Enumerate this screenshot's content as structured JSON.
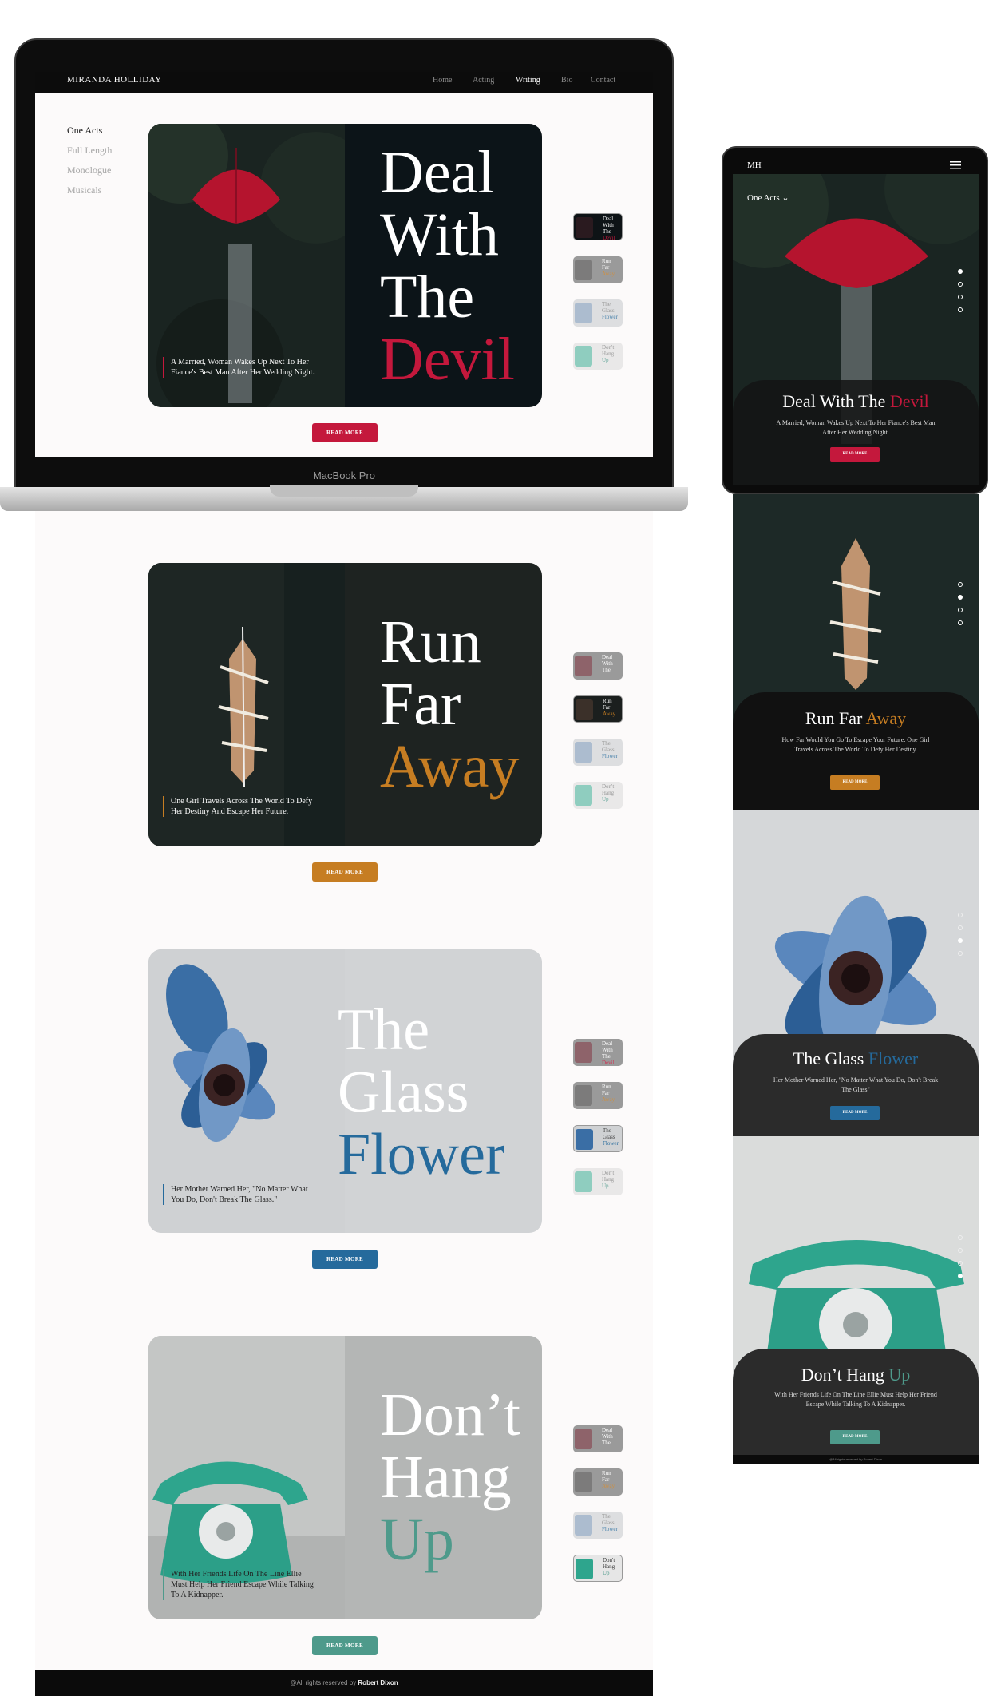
{
  "desktop": {
    "brand": "MIRANDA HOLLIDAY",
    "nav": [
      "Home",
      "Acting",
      "Writing",
      "Bio",
      "Contact"
    ],
    "nav_active": "Writing",
    "sidebar": [
      "One Acts",
      "Full Length",
      "Monologue",
      "Musicals"
    ],
    "device_label": "MacBook Pro",
    "read_more": "READ MORE",
    "footer": {
      "prefix": "@All rights reserved by",
      "name": "Robert Dixon"
    }
  },
  "plays": [
    {
      "title_line1": "Deal",
      "title_line2": "With",
      "title_line3": "The",
      "title_accent": "Devil",
      "accent_color": "#c4183c",
      "tagline": "A Married, Woman Wakes Up Next To Her Fiance's Best Man After Her Wedding Night.",
      "mobile_title": "Deal With The",
      "mobile_accent": "Devil",
      "mobile_desc": "A Married, Woman Wakes Up Next To Her Fiance's Best Man After Her Wedding Night."
    },
    {
      "title_line1": "Run",
      "title_line2": "Far",
      "title_line3": "",
      "title_accent": "Away",
      "accent_color": "#c67d22",
      "tagline": "One Girl Travels Across The World To Defy Her Destiny And Escape Her Future.",
      "mobile_title": "Run Far",
      "mobile_accent": "Away",
      "mobile_desc": "How Far Would You Go To Escape Your Future. One Girl Travels Across The World To Defy Her Destiny."
    },
    {
      "title_line1": "The",
      "title_line2": "Glass",
      "title_line3": "",
      "title_accent": "Flower",
      "accent_color": "#256a9c",
      "tagline": "Her Mother Warned Her, \"No Matter What You Do, Don't Break The Glass.\"",
      "mobile_title": "The Glass",
      "mobile_accent": "Flower",
      "mobile_desc": "Her Mother Warned Her, \"No Matter What You Do, Don't Break The Glass\""
    },
    {
      "title_line1": "Don’t",
      "title_line2": "Hang",
      "title_line3": "",
      "title_accent": "Up",
      "accent_color": "#4e9a8b",
      "tagline": "With Her Friends Life On The Line Ellie Must Help Her Friend Escape While Talking To A Kidnapper.",
      "mobile_title": "Don’t Hang",
      "mobile_accent": "Up",
      "mobile_desc": "With Her Friends Life On The Line Ellie Must Help Her Friend Escape While Talking To A Kidnapper."
    }
  ],
  "thumbs": [
    {
      "l1": "Deal",
      "l2": "With",
      "l3": "The",
      "l4": "Devil"
    },
    {
      "l1": "Run",
      "l2": "Far",
      "l3": "Away",
      "l4": ""
    },
    {
      "l1": "The",
      "l2": "Glass",
      "l3": "Flower",
      "l4": ""
    },
    {
      "l1": "Don't",
      "l2": "Hang",
      "l3": "Up",
      "l4": ""
    }
  ],
  "mobile": {
    "logo": "MH",
    "dropdown": "One Acts",
    "read_more": "READ MORE",
    "footer": "@All rights reserved by Robert Dixon"
  },
  "colors": {
    "devil": "#c4183c",
    "away": "#c67d22",
    "flower": "#256a9c",
    "up": "#4e9a8b"
  },
  "icons": [
    "hamburger-menu-icon",
    "chevron-down-icon",
    "umbrella-image",
    "ship-image",
    "flower-image",
    "telephone-image"
  ]
}
